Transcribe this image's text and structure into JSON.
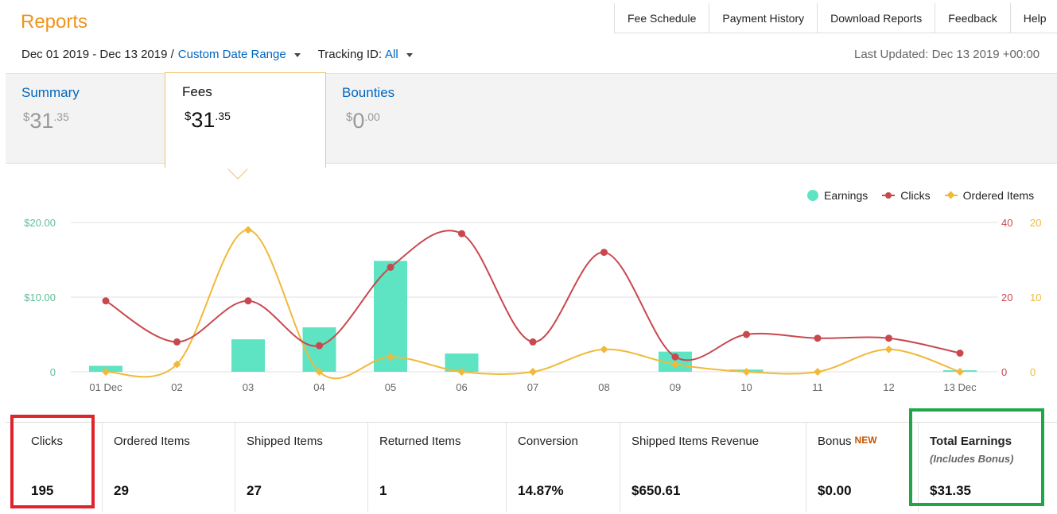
{
  "header": {
    "title": "Reports",
    "nav": [
      "Fee Schedule",
      "Payment History",
      "Download Reports",
      "Feedback",
      "Help"
    ],
    "date_range": "Dec 01 2019 - Dec 13 2019 /",
    "custom_range": "Custom Date Range",
    "tracking_label": "Tracking ID:",
    "tracking_value": "All",
    "last_updated": "Last Updated: Dec 13 2019 +00:00"
  },
  "tabs": [
    {
      "label": "Summary",
      "currency": "$",
      "whole": "31",
      "fraction": ".35",
      "active": false
    },
    {
      "label": "Fees",
      "currency": "$",
      "whole": "31",
      "fraction": ".35",
      "active": true
    },
    {
      "label": "Bounties",
      "currency": "$",
      "whole": "0",
      "fraction": ".00",
      "active": false
    }
  ],
  "legend": {
    "earnings": "Earnings",
    "clicks": "Clicks",
    "ordered": "Ordered Items"
  },
  "colors": {
    "earnings": "#5ee3c3",
    "clicks": "#c9484f",
    "ordered": "#f0b93a",
    "accent": "#f1931a",
    "link": "#0066c0"
  },
  "chart_data": {
    "type": "bar",
    "categories": [
      "01 Dec",
      "02",
      "03",
      "04",
      "05",
      "06",
      "07",
      "08",
      "09",
      "10",
      "11",
      "12",
      "13 Dec"
    ],
    "series": [
      {
        "name": "Earnings",
        "type": "bar",
        "axis": "left",
        "values": [
          0.8,
          0,
          4.35,
          5.95,
          14.85,
          2.45,
          0,
          0,
          2.7,
          0.3,
          0,
          0,
          0.2
        ]
      },
      {
        "name": "Clicks",
        "type": "line",
        "axis": "right-1",
        "values": [
          19,
          8,
          19,
          7,
          28,
          37,
          8,
          32,
          4,
          10,
          9,
          9,
          5
        ]
      },
      {
        "name": "Ordered Items",
        "type": "line",
        "axis": "right-2",
        "values": [
          0,
          1,
          19,
          0,
          2,
          0,
          0,
          3,
          1,
          0,
          0,
          3,
          0
        ]
      }
    ],
    "yaxis_left": {
      "ticks": [
        "0",
        "$10.00",
        "$20.00"
      ],
      "ylim": [
        0,
        20
      ]
    },
    "yaxis_right1": {
      "ticks": [
        "0",
        "20",
        "40"
      ],
      "ylim": [
        0,
        40
      ]
    },
    "yaxis_right2": {
      "ticks": [
        "0",
        "10",
        "20"
      ],
      "ylim": [
        0,
        20
      ]
    },
    "grid": true,
    "legend_position": "top-right"
  },
  "stats": [
    {
      "label": "Clicks",
      "value": "195"
    },
    {
      "label": "Ordered Items",
      "value": "29"
    },
    {
      "label": "Shipped Items",
      "value": "27"
    },
    {
      "label": "Returned Items",
      "value": "1"
    },
    {
      "label": "Conversion",
      "value": "14.87%"
    },
    {
      "label": "Shipped Items Revenue",
      "value": "$650.61"
    },
    {
      "label": "Bonus",
      "badge": "NEW",
      "value": "$0.00"
    },
    {
      "label": "Total Earnings",
      "sub": "(Includes Bonus)",
      "value": "$31.35"
    }
  ]
}
